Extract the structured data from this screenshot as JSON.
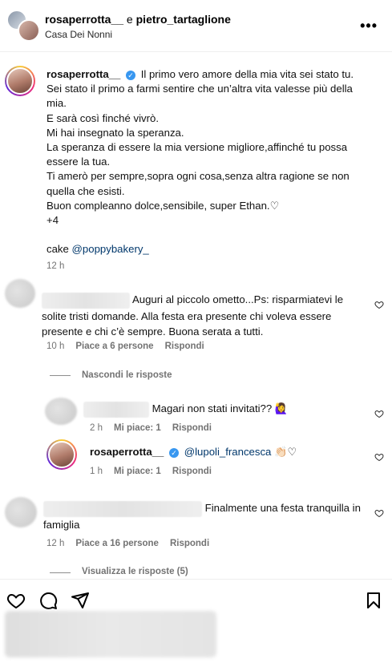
{
  "header": {
    "user1": "rosaperrotta__",
    "joiner": " e ",
    "user2": "pietro_tartaglione",
    "location": "Casa Dei Nonni",
    "more": "•••"
  },
  "caption": {
    "username": "rosaperrotta__",
    "verified_mark": "✓",
    "lines": [
      "Il primo vero amore della mia vita sei stato tu.",
      "Sei stato il primo a farmi sentire che un’altra vita valesse più della mia.",
      "E sarà così finché vivrò.",
      "Mi hai insegnato la speranza.",
      "La speranza di essere la mia versione migliore,affinché tu possa essere la tua.",
      "Ti amerò per sempre,sopra ogni cosa,senza altra ragione se non quella che esisti.",
      "Buon compleanno dolce,sensibile, super Ethan.♡",
      "+4"
    ],
    "cake_prefix": "cake ",
    "cake_mention": "@poppybakery_",
    "time": "12 h"
  },
  "comments": [
    {
      "text": "Auguri al piccolo ometto...Ps: risparmiatevi le solite tristi domande. Alla festa era presente chi voleva essere presente e chi c’è sempre. Buona serata a tutti.",
      "time": "10 h",
      "likes": "Piace a 6 persone",
      "reply": "Rispondi",
      "toggle": "Nascondi le risposte"
    },
    {
      "text": "Magari non stati invitati?? 🙋‍♀️",
      "time": "2 h",
      "likes": "Mi piace: 1",
      "reply": "Rispondi"
    },
    {
      "username": "rosaperrotta__",
      "verified_mark": "✓",
      "mention": "@lupoli_francesca",
      "emoji": "👏🏻♡",
      "time": "1 h",
      "likes": "Mi piace: 1",
      "reply": "Rispondi"
    },
    {
      "text": "Finalmente una festa tranquilla in famiglia",
      "time": "12 h",
      "likes": "Piace a 16 persone",
      "reply": "Rispondi",
      "toggle": "Visualizza le risposte (5)"
    }
  ],
  "icons": [
    "heart-icon",
    "comment-icon",
    "share-icon",
    "bookmark-icon"
  ]
}
